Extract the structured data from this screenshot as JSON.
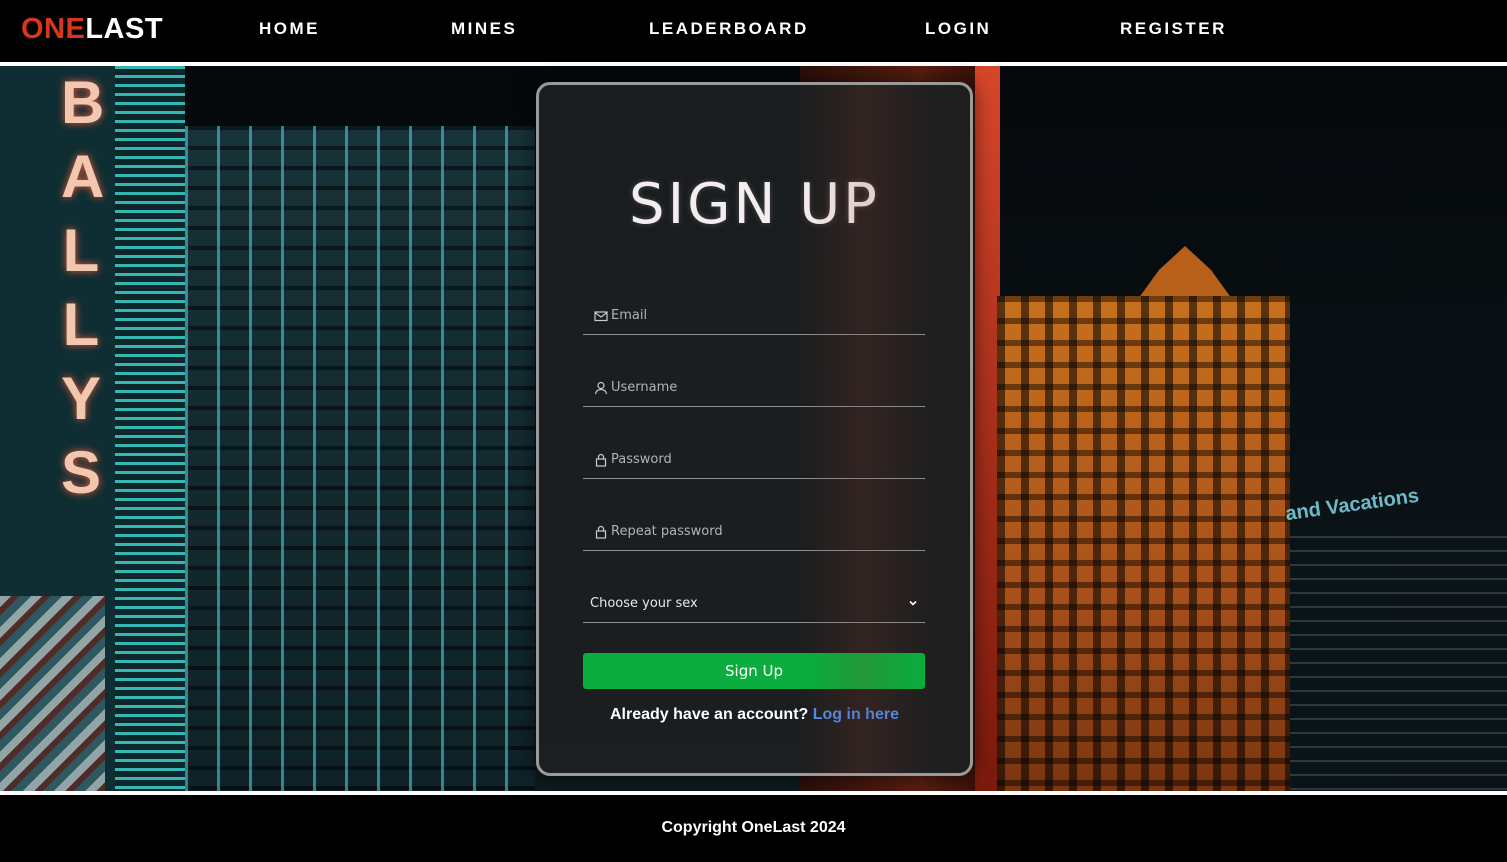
{
  "brand": {
    "part1": "ONE",
    "part2": "LAST",
    "accent_color": "#d8361f"
  },
  "nav": {
    "items": [
      {
        "label": "HOME"
      },
      {
        "label": "MINES"
      },
      {
        "label": "LEADERBOARD"
      },
      {
        "label": "LOGIN"
      },
      {
        "label": "REGISTER"
      }
    ]
  },
  "background": {
    "sign_letters": "BALLYS",
    "sign_text": "and Vacations"
  },
  "form": {
    "title": "SIGN UP",
    "email": {
      "placeholder": "Email",
      "icon": "mail-icon"
    },
    "username": {
      "placeholder": "Username",
      "icon": "user-icon"
    },
    "password": {
      "placeholder": "Password",
      "icon": "lock-icon"
    },
    "repeat_password": {
      "placeholder": "Repeat password",
      "icon": "lock-icon"
    },
    "sex_select": {
      "selected": "Choose your sex"
    },
    "submit_label": "Sign Up",
    "submit_color": "#0aad3e",
    "login_prompt": "Already have an account?",
    "login_link": "Log in here",
    "link_color": "#4e8dee"
  },
  "footer": {
    "copyright": "Copyright OneLast 2024"
  }
}
